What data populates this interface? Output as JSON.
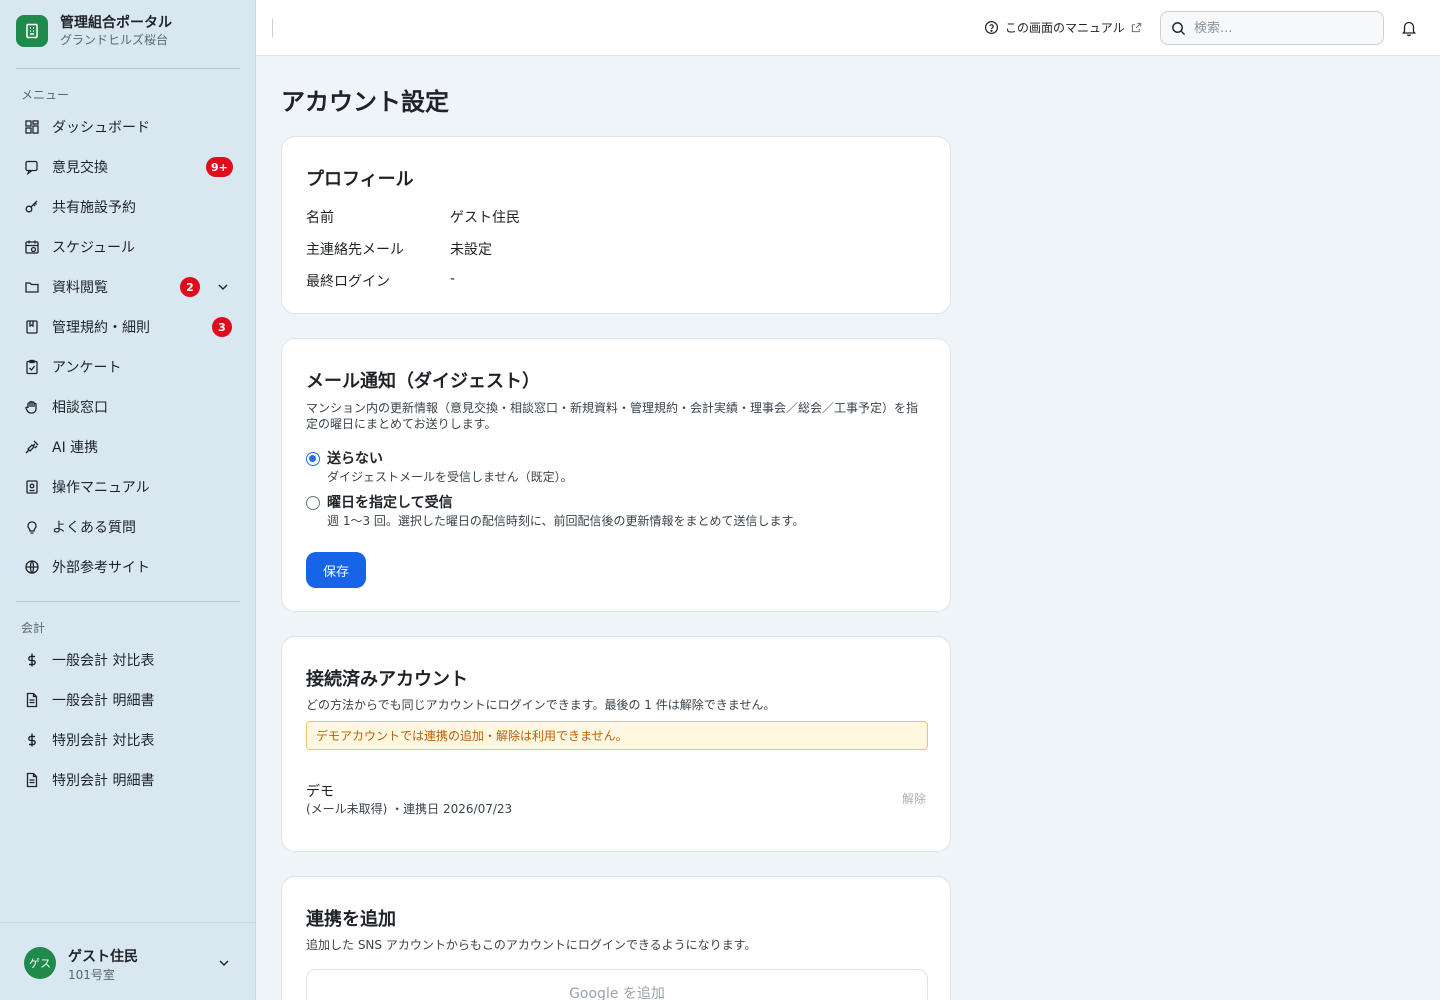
{
  "brand": {
    "title": "管理組合ポータル",
    "subtitle": "グランドヒルズ桜台"
  },
  "sidebar": {
    "menu_label": "メニュー",
    "items": [
      {
        "label": "ダッシュボード",
        "icon": "dashboard-icon"
      },
      {
        "label": "意見交換",
        "icon": "chat-icon",
        "badge": "9+"
      },
      {
        "label": "共有施設予約",
        "icon": "key-icon"
      },
      {
        "label": "スケジュール",
        "icon": "calendar-icon"
      },
      {
        "label": "資料閲覧",
        "icon": "folder-icon",
        "badge": "2",
        "expandable": true
      },
      {
        "label": "管理規約・細則",
        "icon": "book-icon",
        "badge": "3"
      },
      {
        "label": "アンケート",
        "icon": "clipboard-icon"
      },
      {
        "label": "相談窓口",
        "icon": "hand-icon"
      },
      {
        "label": "AI 連携",
        "icon": "plug-icon"
      },
      {
        "label": "操作マニュアル",
        "icon": "manual-icon"
      },
      {
        "label": "よくある質問",
        "icon": "lightbulb-icon"
      },
      {
        "label": "外部参考サイト",
        "icon": "globe-icon"
      }
    ],
    "accounting_label": "会計",
    "accounting_items": [
      {
        "label": "一般会計 対比表",
        "icon": "dollar-icon"
      },
      {
        "label": "一般会計 明細書",
        "icon": "document-icon"
      },
      {
        "label": "特別会計 対比表",
        "icon": "dollar-icon"
      },
      {
        "label": "特別会計 明細書",
        "icon": "document-icon"
      }
    ]
  },
  "user": {
    "avatar": "ゲス",
    "name": "ゲスト住民",
    "room": "101号室"
  },
  "topbar": {
    "manual_link": "この画面のマニュアル",
    "search_placeholder": "検索..."
  },
  "page": {
    "title": "アカウント設定"
  },
  "profile": {
    "title": "プロフィール",
    "rows": [
      {
        "label": "名前",
        "value": "ゲスト住民"
      },
      {
        "label": "主連絡先メール",
        "value": "未設定"
      },
      {
        "label": "最終ログイン",
        "value": "-"
      }
    ]
  },
  "digest": {
    "title": "メール通知（ダイジェスト）",
    "description_line1": "マンション内の更新情報（意見交換・相談窓口・新規資料・管理規約・会計実績・理事会／総会／工事予定）を指",
    "description_line2": "定の曜日にまとめてお送りします。",
    "options": [
      {
        "label": "送らない",
        "sub": "ダイジェストメールを受信しません（既定）。",
        "checked": true
      },
      {
        "label": "曜日を指定して受信",
        "sub": "週 1〜3 回。選択した曜日の配信時刻に、前回配信後の更新情報をまとめて送信します。",
        "checked": false
      }
    ],
    "save_label": "保存"
  },
  "connected": {
    "title": "接続済みアカウント",
    "description": "どの方法からでも同じアカウントにログインできます。最後の 1 件は解除できません。",
    "warning": "デモアカウントでは連携の追加・解除は利用できません。",
    "account": {
      "name": "デモ",
      "meta": "(メール未取得) ・連携日 2026/07/23",
      "remove_label": "解除"
    }
  },
  "add_link": {
    "title": "連携を追加",
    "description": "追加した SNS アカウントからもこのアカウントにログインできるようになります。",
    "google_label": "Google を追加"
  },
  "colors": {
    "brand_green": "#1f8a4c",
    "primary_blue": "#1764e8",
    "badge_red": "#e00b1c",
    "sidebar_bg": "#d9e7f1"
  }
}
